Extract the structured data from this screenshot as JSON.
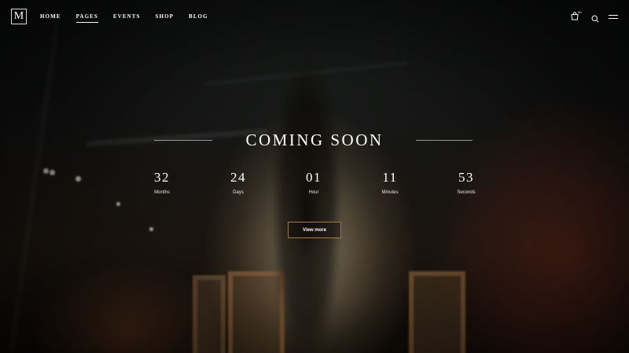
{
  "brand": {
    "logo_letter": "M"
  },
  "nav": {
    "items": [
      {
        "label": "HOME",
        "active": false
      },
      {
        "label": "PAGES",
        "active": true
      },
      {
        "label": "EVENTS",
        "active": false
      },
      {
        "label": "SHOP",
        "active": false
      },
      {
        "label": "BLOG",
        "active": false
      }
    ]
  },
  "header_tools": {
    "cart_icon": "cart-icon",
    "cart_count": "00",
    "search_icon": "search-icon",
    "menu_icon": "hamburger-menu-icon"
  },
  "hero": {
    "title": "COMING SOON",
    "countdown": [
      {
        "value": "32",
        "label": "Months"
      },
      {
        "value": "24",
        "label": "Days"
      },
      {
        "value": "01",
        "label": "Hour"
      },
      {
        "value": "11",
        "label": "Minutes"
      },
      {
        "value": "53",
        "label": "Seconds"
      }
    ],
    "button_label": "View more"
  },
  "colors": {
    "button_border": "#9a7a55",
    "text": "#ffffff"
  }
}
